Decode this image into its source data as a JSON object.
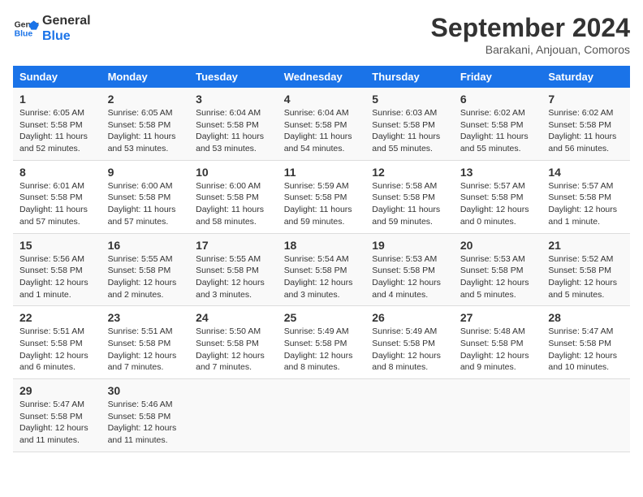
{
  "header": {
    "logo_line1": "General",
    "logo_line2": "Blue",
    "month": "September 2024",
    "location": "Barakani, Anjouan, Comoros"
  },
  "weekdays": [
    "Sunday",
    "Monday",
    "Tuesday",
    "Wednesday",
    "Thursday",
    "Friday",
    "Saturday"
  ],
  "weeks": [
    [
      {
        "day": "1",
        "info": "Sunrise: 6:05 AM\nSunset: 5:58 PM\nDaylight: 11 hours\nand 52 minutes."
      },
      {
        "day": "2",
        "info": "Sunrise: 6:05 AM\nSunset: 5:58 PM\nDaylight: 11 hours\nand 53 minutes."
      },
      {
        "day": "3",
        "info": "Sunrise: 6:04 AM\nSunset: 5:58 PM\nDaylight: 11 hours\nand 53 minutes."
      },
      {
        "day": "4",
        "info": "Sunrise: 6:04 AM\nSunset: 5:58 PM\nDaylight: 11 hours\nand 54 minutes."
      },
      {
        "day": "5",
        "info": "Sunrise: 6:03 AM\nSunset: 5:58 PM\nDaylight: 11 hours\nand 55 minutes."
      },
      {
        "day": "6",
        "info": "Sunrise: 6:02 AM\nSunset: 5:58 PM\nDaylight: 11 hours\nand 55 minutes."
      },
      {
        "day": "7",
        "info": "Sunrise: 6:02 AM\nSunset: 5:58 PM\nDaylight: 11 hours\nand 56 minutes."
      }
    ],
    [
      {
        "day": "8",
        "info": "Sunrise: 6:01 AM\nSunset: 5:58 PM\nDaylight: 11 hours\nand 57 minutes."
      },
      {
        "day": "9",
        "info": "Sunrise: 6:00 AM\nSunset: 5:58 PM\nDaylight: 11 hours\nand 57 minutes."
      },
      {
        "day": "10",
        "info": "Sunrise: 6:00 AM\nSunset: 5:58 PM\nDaylight: 11 hours\nand 58 minutes."
      },
      {
        "day": "11",
        "info": "Sunrise: 5:59 AM\nSunset: 5:58 PM\nDaylight: 11 hours\nand 59 minutes."
      },
      {
        "day": "12",
        "info": "Sunrise: 5:58 AM\nSunset: 5:58 PM\nDaylight: 11 hours\nand 59 minutes."
      },
      {
        "day": "13",
        "info": "Sunrise: 5:57 AM\nSunset: 5:58 PM\nDaylight: 12 hours\nand 0 minutes."
      },
      {
        "day": "14",
        "info": "Sunrise: 5:57 AM\nSunset: 5:58 PM\nDaylight: 12 hours\nand 1 minute."
      }
    ],
    [
      {
        "day": "15",
        "info": "Sunrise: 5:56 AM\nSunset: 5:58 PM\nDaylight: 12 hours\nand 1 minute."
      },
      {
        "day": "16",
        "info": "Sunrise: 5:55 AM\nSunset: 5:58 PM\nDaylight: 12 hours\nand 2 minutes."
      },
      {
        "day": "17",
        "info": "Sunrise: 5:55 AM\nSunset: 5:58 PM\nDaylight: 12 hours\nand 3 minutes."
      },
      {
        "day": "18",
        "info": "Sunrise: 5:54 AM\nSunset: 5:58 PM\nDaylight: 12 hours\nand 3 minutes."
      },
      {
        "day": "19",
        "info": "Sunrise: 5:53 AM\nSunset: 5:58 PM\nDaylight: 12 hours\nand 4 minutes."
      },
      {
        "day": "20",
        "info": "Sunrise: 5:53 AM\nSunset: 5:58 PM\nDaylight: 12 hours\nand 5 minutes."
      },
      {
        "day": "21",
        "info": "Sunrise: 5:52 AM\nSunset: 5:58 PM\nDaylight: 12 hours\nand 5 minutes."
      }
    ],
    [
      {
        "day": "22",
        "info": "Sunrise: 5:51 AM\nSunset: 5:58 PM\nDaylight: 12 hours\nand 6 minutes."
      },
      {
        "day": "23",
        "info": "Sunrise: 5:51 AM\nSunset: 5:58 PM\nDaylight: 12 hours\nand 7 minutes."
      },
      {
        "day": "24",
        "info": "Sunrise: 5:50 AM\nSunset: 5:58 PM\nDaylight: 12 hours\nand 7 minutes."
      },
      {
        "day": "25",
        "info": "Sunrise: 5:49 AM\nSunset: 5:58 PM\nDaylight: 12 hours\nand 8 minutes."
      },
      {
        "day": "26",
        "info": "Sunrise: 5:49 AM\nSunset: 5:58 PM\nDaylight: 12 hours\nand 8 minutes."
      },
      {
        "day": "27",
        "info": "Sunrise: 5:48 AM\nSunset: 5:58 PM\nDaylight: 12 hours\nand 9 minutes."
      },
      {
        "day": "28",
        "info": "Sunrise: 5:47 AM\nSunset: 5:58 PM\nDaylight: 12 hours\nand 10 minutes."
      }
    ],
    [
      {
        "day": "29",
        "info": "Sunrise: 5:47 AM\nSunset: 5:58 PM\nDaylight: 12 hours\nand 11 minutes."
      },
      {
        "day": "30",
        "info": "Sunrise: 5:46 AM\nSunset: 5:58 PM\nDaylight: 12 hours\nand 11 minutes."
      },
      {
        "day": "",
        "info": ""
      },
      {
        "day": "",
        "info": ""
      },
      {
        "day": "",
        "info": ""
      },
      {
        "day": "",
        "info": ""
      },
      {
        "day": "",
        "info": ""
      }
    ]
  ]
}
